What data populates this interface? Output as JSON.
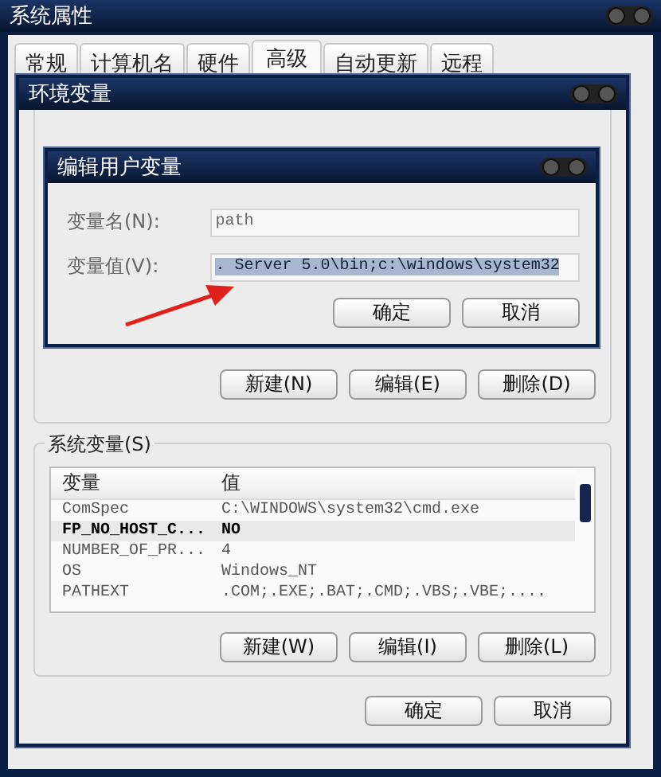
{
  "window": {
    "title": "系统属性"
  },
  "tabs": [
    {
      "label": "常规",
      "selected": false
    },
    {
      "label": "计算机名",
      "selected": false
    },
    {
      "label": "硬件",
      "selected": false
    },
    {
      "label": "高级",
      "selected": true
    },
    {
      "label": "自动更新",
      "selected": false
    },
    {
      "label": "远程",
      "selected": false
    }
  ],
  "env_window": {
    "title": "环境变量",
    "user_buttons": [
      "新建(N)",
      "编辑(E)",
      "删除(D)"
    ],
    "system_group": {
      "label": "系统变量(S)",
      "columns": [
        "变量",
        "值"
      ],
      "rows": [
        {
          "name": "ComSpec",
          "value": "C:\\WINDOWS\\system32\\cmd.exe",
          "selected": false
        },
        {
          "name": "FP_NO_HOST_C...",
          "value": "NO",
          "selected": true
        },
        {
          "name": "NUMBER_OF_PR...",
          "value": "4",
          "selected": false
        },
        {
          "name": "OS",
          "value": "Windows_NT",
          "selected": false
        },
        {
          "name": "PATHEXT",
          "value": ".COM;.EXE;.BAT;.CMD;.VBS;.VBE;....",
          "selected": false
        }
      ]
    },
    "system_buttons": [
      "新建(W)",
      "编辑(I)",
      "删除(L)"
    ],
    "buttons": [
      "确定",
      "取消"
    ]
  },
  "edit_dialog": {
    "title": "编辑用户变量",
    "fields": [
      {
        "label": "变量名(N):",
        "value": "path",
        "selected": false
      },
      {
        "label": "变量值(V):",
        "value": ". Server 5.0\\bin;c:\\windows\\system32",
        "selected": true
      }
    ],
    "buttons": [
      "确定",
      "取消"
    ]
  }
}
